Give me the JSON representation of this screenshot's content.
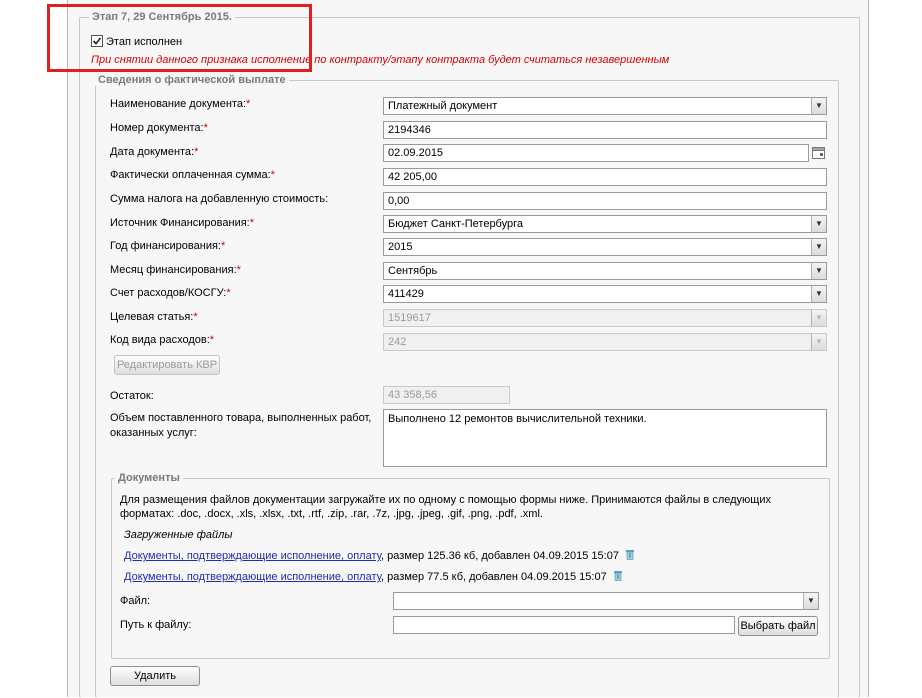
{
  "stage": {
    "legend": "Этап 7, 29 Сентябрь 2015.",
    "checkbox_label": "Этап исполнен",
    "checked": true,
    "warning": "При снятии данного признака исполнение по контракту/этапу контракта будет считаться незавершенным"
  },
  "payment": {
    "legend": "Сведения о фактической выплате",
    "fields": {
      "doc_name": {
        "label": "Наименование документа:",
        "value": "Платежный документ"
      },
      "doc_number": {
        "label": "Номер документа:",
        "value": "2194346"
      },
      "doc_date": {
        "label": "Дата документа:",
        "value": "02.09.2015"
      },
      "paid_sum": {
        "label": "Фактически оплаченная сумма:",
        "value": "42 205,00"
      },
      "vat_sum": {
        "label": "Сумма налога на добавленную стоимость:",
        "value": "0,00"
      },
      "source": {
        "label": "Источник Финансирования:",
        "value": "Бюджет Санкт-Петербурга"
      },
      "year": {
        "label": "Год финансирования:",
        "value": "2015"
      },
      "month": {
        "label": "Месяц финансирования:",
        "value": "Сентябрь"
      },
      "account": {
        "label": "Счет расходов/КОСГУ:",
        "value": "411429"
      },
      "target": {
        "label": "Целевая статья:",
        "value": "1519617"
      },
      "kvr": {
        "label": "Код вида расходов:",
        "value": "242"
      },
      "remainder": {
        "label": "Остаток:",
        "value": "43 358,56"
      },
      "volume_line1": "Объем поставленного товара, выполненных работ,",
      "volume_line2": "оказанных услуг:",
      "volume_value": "Выполнено 12 ремонтов вычислительной техники."
    },
    "edit_kvr_button": "Редактировать КВР",
    "required_mark": "*"
  },
  "documents": {
    "legend": "Документы",
    "info_line1": "Для размещения файлов документации загружайте их по одному с помощью формы ниже. Принимаются файлы в следующих",
    "info_line2": "форматах: .doc, .docx, .xls, .xlsx, .txt, .rtf, .zip, .rar, .7z, .jpg, .jpeg, .gif, .png, .pdf, .xml.",
    "uploaded_title": "Загруженные файлы",
    "files": [
      {
        "name": "Документы, подтверждающие исполнение, оплату",
        "meta": ", размер 125.36 кб, добавлен 04.09.2015 15:07"
      },
      {
        "name": "Документы, подтверждающие исполнение, оплату",
        "meta": ", размер 77.5 кб, добавлен 04.09.2015 15:07"
      }
    ],
    "file_label": "Файл:",
    "file_value": "",
    "path_label": "Путь к файлу:",
    "path_value": "",
    "choose_button": "Выбрать файл"
  },
  "delete_button": "Удалить",
  "colors": {
    "highlight_frame": "#e02020",
    "required": "#d40000",
    "link": "#1f2ea8"
  },
  "icons": {
    "checkbox": "checkbox-checked-icon",
    "calendar": "calendar-icon",
    "dropdown": "chevron-down-icon",
    "trash": "trash-icon"
  }
}
